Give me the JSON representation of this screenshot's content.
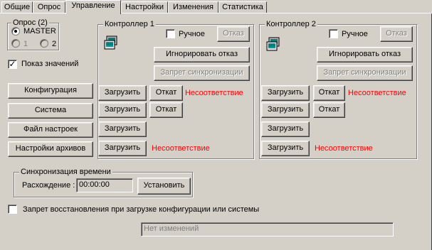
{
  "tabs": [
    "Общие",
    "Опрос",
    "Управление",
    "Настройки",
    "Изменения",
    "Статистика"
  ],
  "active_tab": "Управление",
  "poll_group": {
    "title": "Опрос (2)",
    "master_label": "MASTER",
    "radio1_label": "1",
    "radio2_label": "2"
  },
  "show_values_label": "Показ значений",
  "left_buttons": {
    "config": "Конфигурация",
    "system": "Система",
    "settings_file": "Файл настроек",
    "archive_settings": "Настройки архивов"
  },
  "controller1": {
    "title": "Контроллер 1",
    "manual_label": "Ручное",
    "fault_button": "Отказ",
    "ignore_fault_button": "Игнорировать отказ",
    "sync_ban_button": "Запрет синхронизации",
    "rows": [
      {
        "load": "Загрузить",
        "rollback": "Откат",
        "status": "Несоответствие"
      },
      {
        "load": "Загрузить",
        "rollback": "Откат",
        "status": ""
      },
      {
        "load": "Загрузить",
        "rollback": "",
        "status": ""
      },
      {
        "load": "Загрузить",
        "rollback": "",
        "status": "Несоответствие"
      }
    ]
  },
  "controller2": {
    "title": "Контроллер 2",
    "manual_label": "Ручное",
    "fault_button": "Отказ",
    "ignore_fault_button": "Игнорировать отказ",
    "sync_ban_button": "Запрет синхронизации",
    "rows": [
      {
        "load": "Загрузить",
        "rollback": "Откат",
        "status": "Несоответствие"
      },
      {
        "load": "Загрузить",
        "rollback": "Откат",
        "status": ""
      },
      {
        "load": "Загрузить",
        "rollback": "",
        "status": ""
      },
      {
        "load": "Загрузить",
        "rollback": "",
        "status": "Несоответствие"
      }
    ]
  },
  "time_sync": {
    "title": "Синхронизация времени",
    "drift_label": "Расхождение :",
    "drift_value": "00:00:00",
    "set_button": "Установить"
  },
  "restore_ban_label": "Запрет восстановления при загрузке конфигурации или системы",
  "status_field": "Нет изменений",
  "colors": {
    "background": "#d4d0c8",
    "warning": "#ff0000"
  },
  "icons": {
    "controller": "controller-icon"
  }
}
